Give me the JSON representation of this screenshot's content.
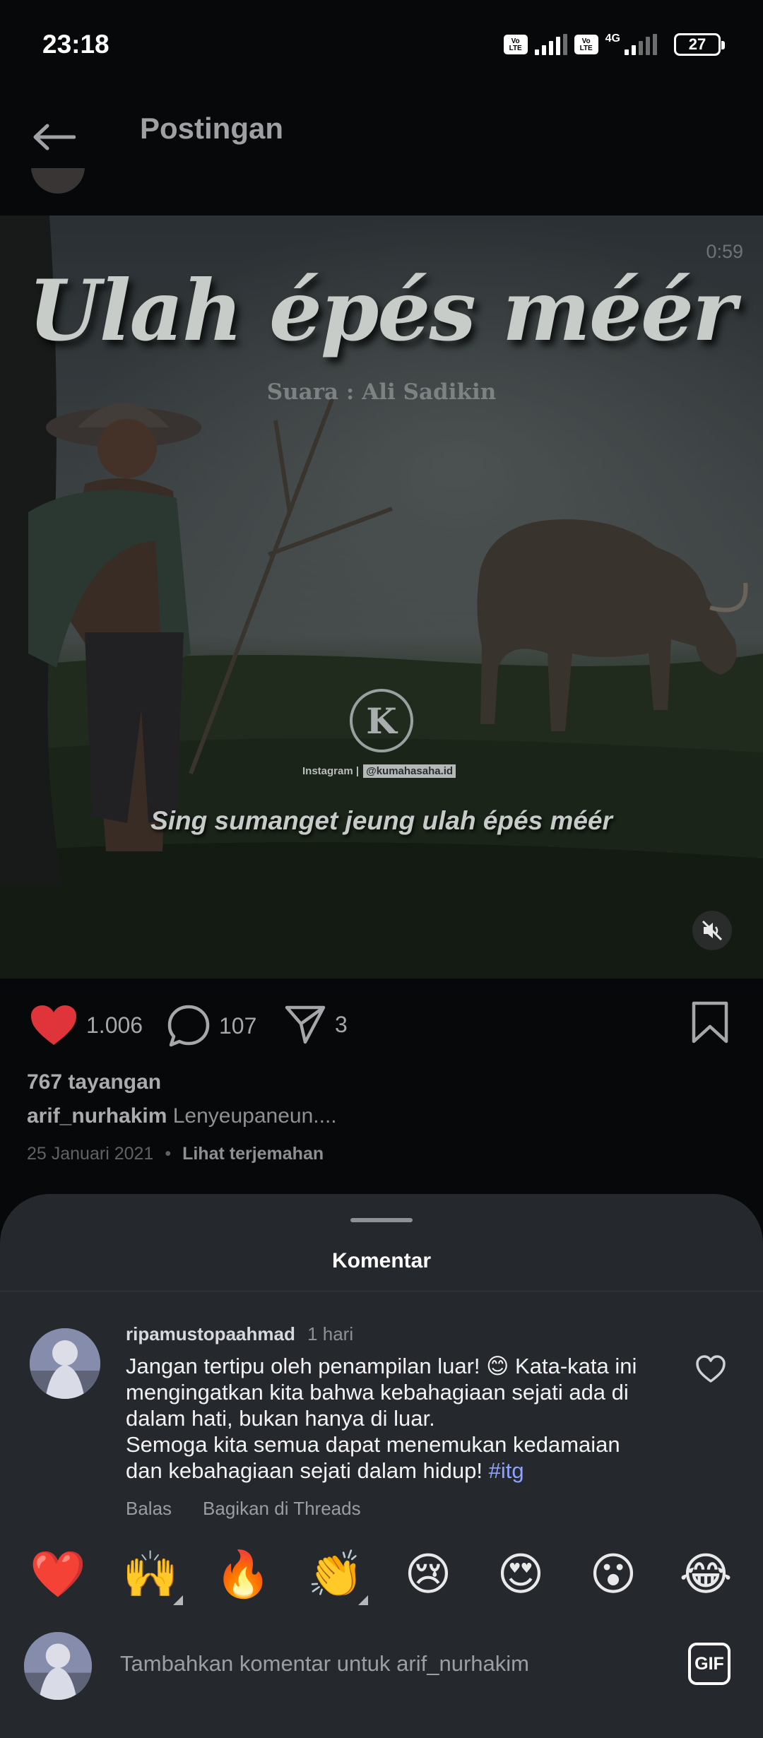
{
  "status_bar": {
    "time": "23:18",
    "volte_label": "Vo LTE",
    "network_label": "4G",
    "battery": "27"
  },
  "app_bar": {
    "title": "Postingan"
  },
  "post": {
    "video": {
      "duration": "0:59",
      "title": "Ulah épés méér",
      "credit": "Suara : Ali Sadikin",
      "instagram_label": "Instagram |",
      "instagram_handle": "@kumahasaha.id",
      "caption": "Sing sumanget jeung ulah épés méér",
      "muted": true
    },
    "likes": "1.006",
    "comments": "107",
    "shares": "3",
    "views": "767 tayangan",
    "author": "arif_nurhakim",
    "caption": "Lenyeupaneun....",
    "date": "25 Januari 2021",
    "translate_label": "Lihat terjemahan",
    "like_color": "#e0343b"
  },
  "comments_sheet": {
    "title": "Komentar",
    "comment": {
      "username": "ripamustopaahmad",
      "time": "1 hari",
      "lines": [
        "Jangan tertipu oleh penampilan luar! 😊 Kata-kata ini",
        "mengingatkan kita bahwa kebahagiaan sejati ada di",
        "dalam hati, bukan hanya di luar.",
        "Semoga kita semua dapat menemukan kedamaian"
      ],
      "last_line_text": "dan kebahagiaan sejati dalam hidup! ",
      "hashtag": "#itg",
      "reply_label": "Balas",
      "share_threads_label": "Bagikan di Threads"
    },
    "emoji_reactions": [
      "❤️",
      "🙌",
      "🔥",
      "👏",
      "😢",
      "😍",
      "😮",
      "😂"
    ],
    "compose": {
      "placeholder": "Tambahkan komentar untuk arif_nurhakim",
      "gif_label": "GIF"
    }
  }
}
